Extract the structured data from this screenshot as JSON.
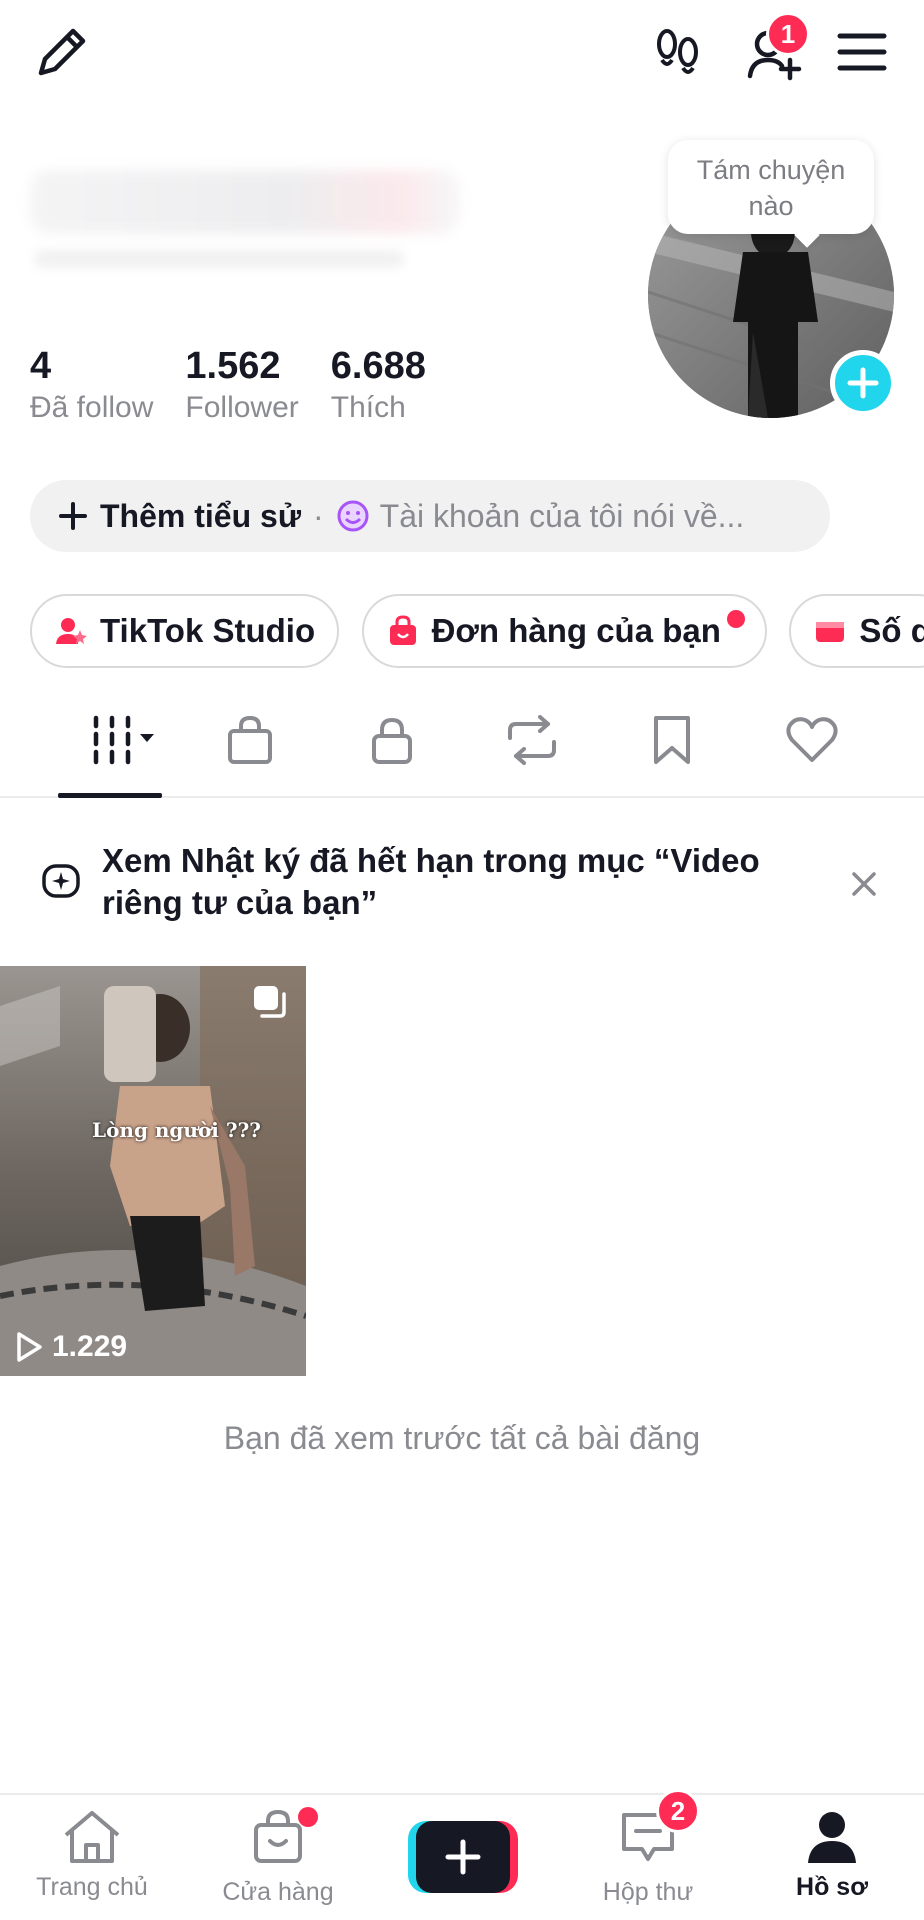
{
  "colors": {
    "accent": "#fe2c55",
    "cyan": "#20d5ec",
    "text": "#161823",
    "muted": "#8a8b91"
  },
  "topbar": {
    "notification_count": "1"
  },
  "bubble": {
    "text_line1": "Tám chuyện",
    "text_line2": "nào"
  },
  "stats": [
    {
      "value": "4",
      "label": "Đã follow"
    },
    {
      "value": "1.562",
      "label": "Follower"
    },
    {
      "value": "6.688",
      "label": "Thích"
    }
  ],
  "bio": {
    "add_label": "Thêm tiểu sử",
    "separator": "·",
    "placeholder": "Tài khoản của tôi nói về..."
  },
  "chips": [
    {
      "label": "TikTok Studio"
    },
    {
      "label": "Đơn hàng của bạn"
    },
    {
      "label": "Số d"
    }
  ],
  "notice": {
    "text": "Xem Nhật ký đã hết hạn trong mục “Video riêng tư của bạn”"
  },
  "video": {
    "caption": "Lòng người ???",
    "views": "1.229"
  },
  "end_text": "Bạn đã xem trước tất cả bài đăng",
  "bottom_nav": {
    "home": "Trang chủ",
    "shop": "Cửa hàng",
    "inbox": "Hộp thư",
    "inbox_count": "2",
    "profile": "Hồ sơ"
  }
}
